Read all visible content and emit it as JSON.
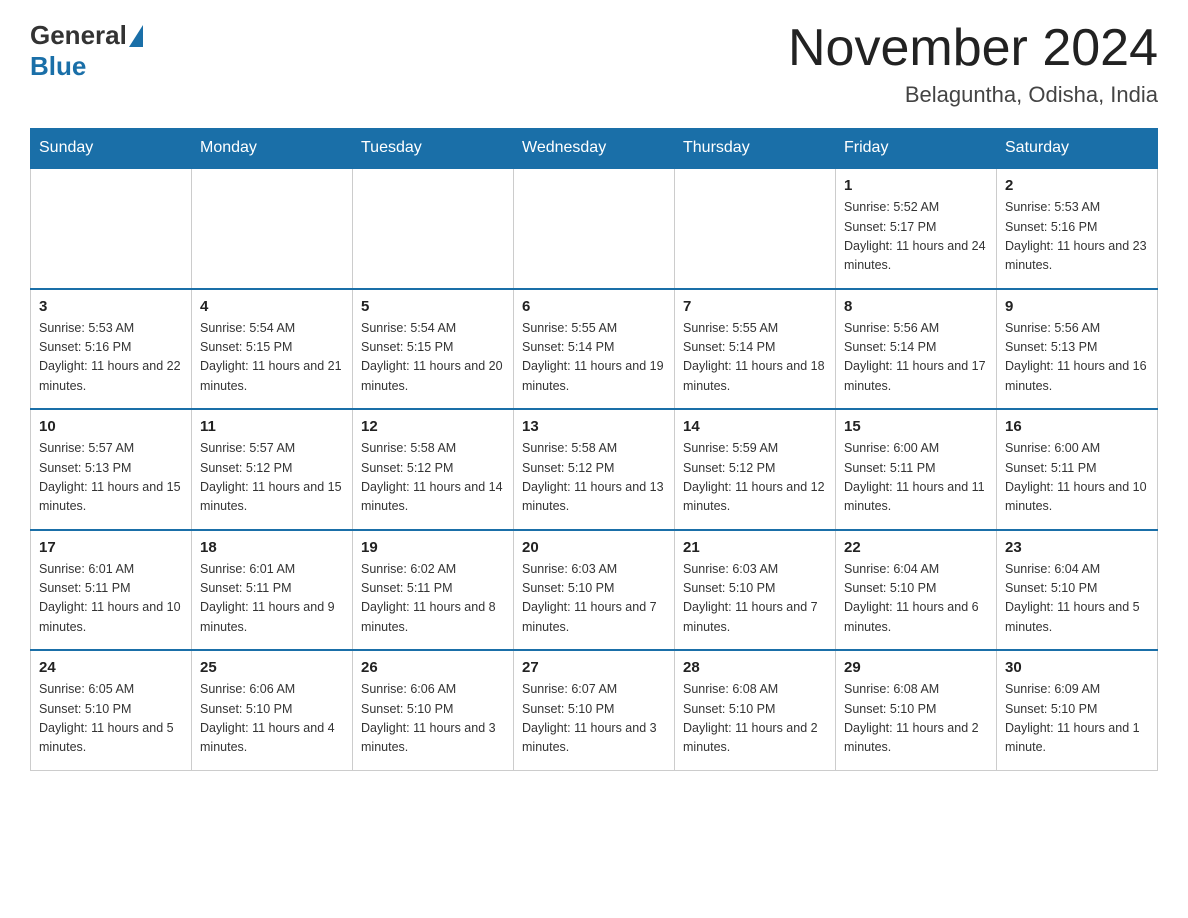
{
  "header": {
    "logo_general": "General",
    "logo_blue": "Blue",
    "title": "November 2024",
    "subtitle": "Belaguntha, Odisha, India"
  },
  "weekdays": [
    "Sunday",
    "Monday",
    "Tuesday",
    "Wednesday",
    "Thursday",
    "Friday",
    "Saturday"
  ],
  "weeks": [
    [
      {
        "day": "",
        "info": ""
      },
      {
        "day": "",
        "info": ""
      },
      {
        "day": "",
        "info": ""
      },
      {
        "day": "",
        "info": ""
      },
      {
        "day": "",
        "info": ""
      },
      {
        "day": "1",
        "info": "Sunrise: 5:52 AM\nSunset: 5:17 PM\nDaylight: 11 hours and 24 minutes."
      },
      {
        "day": "2",
        "info": "Sunrise: 5:53 AM\nSunset: 5:16 PM\nDaylight: 11 hours and 23 minutes."
      }
    ],
    [
      {
        "day": "3",
        "info": "Sunrise: 5:53 AM\nSunset: 5:16 PM\nDaylight: 11 hours and 22 minutes."
      },
      {
        "day": "4",
        "info": "Sunrise: 5:54 AM\nSunset: 5:15 PM\nDaylight: 11 hours and 21 minutes."
      },
      {
        "day": "5",
        "info": "Sunrise: 5:54 AM\nSunset: 5:15 PM\nDaylight: 11 hours and 20 minutes."
      },
      {
        "day": "6",
        "info": "Sunrise: 5:55 AM\nSunset: 5:14 PM\nDaylight: 11 hours and 19 minutes."
      },
      {
        "day": "7",
        "info": "Sunrise: 5:55 AM\nSunset: 5:14 PM\nDaylight: 11 hours and 18 minutes."
      },
      {
        "day": "8",
        "info": "Sunrise: 5:56 AM\nSunset: 5:14 PM\nDaylight: 11 hours and 17 minutes."
      },
      {
        "day": "9",
        "info": "Sunrise: 5:56 AM\nSunset: 5:13 PM\nDaylight: 11 hours and 16 minutes."
      }
    ],
    [
      {
        "day": "10",
        "info": "Sunrise: 5:57 AM\nSunset: 5:13 PM\nDaylight: 11 hours and 15 minutes."
      },
      {
        "day": "11",
        "info": "Sunrise: 5:57 AM\nSunset: 5:12 PM\nDaylight: 11 hours and 15 minutes."
      },
      {
        "day": "12",
        "info": "Sunrise: 5:58 AM\nSunset: 5:12 PM\nDaylight: 11 hours and 14 minutes."
      },
      {
        "day": "13",
        "info": "Sunrise: 5:58 AM\nSunset: 5:12 PM\nDaylight: 11 hours and 13 minutes."
      },
      {
        "day": "14",
        "info": "Sunrise: 5:59 AM\nSunset: 5:12 PM\nDaylight: 11 hours and 12 minutes."
      },
      {
        "day": "15",
        "info": "Sunrise: 6:00 AM\nSunset: 5:11 PM\nDaylight: 11 hours and 11 minutes."
      },
      {
        "day": "16",
        "info": "Sunrise: 6:00 AM\nSunset: 5:11 PM\nDaylight: 11 hours and 10 minutes."
      }
    ],
    [
      {
        "day": "17",
        "info": "Sunrise: 6:01 AM\nSunset: 5:11 PM\nDaylight: 11 hours and 10 minutes."
      },
      {
        "day": "18",
        "info": "Sunrise: 6:01 AM\nSunset: 5:11 PM\nDaylight: 11 hours and 9 minutes."
      },
      {
        "day": "19",
        "info": "Sunrise: 6:02 AM\nSunset: 5:11 PM\nDaylight: 11 hours and 8 minutes."
      },
      {
        "day": "20",
        "info": "Sunrise: 6:03 AM\nSunset: 5:10 PM\nDaylight: 11 hours and 7 minutes."
      },
      {
        "day": "21",
        "info": "Sunrise: 6:03 AM\nSunset: 5:10 PM\nDaylight: 11 hours and 7 minutes."
      },
      {
        "day": "22",
        "info": "Sunrise: 6:04 AM\nSunset: 5:10 PM\nDaylight: 11 hours and 6 minutes."
      },
      {
        "day": "23",
        "info": "Sunrise: 6:04 AM\nSunset: 5:10 PM\nDaylight: 11 hours and 5 minutes."
      }
    ],
    [
      {
        "day": "24",
        "info": "Sunrise: 6:05 AM\nSunset: 5:10 PM\nDaylight: 11 hours and 5 minutes."
      },
      {
        "day": "25",
        "info": "Sunrise: 6:06 AM\nSunset: 5:10 PM\nDaylight: 11 hours and 4 minutes."
      },
      {
        "day": "26",
        "info": "Sunrise: 6:06 AM\nSunset: 5:10 PM\nDaylight: 11 hours and 3 minutes."
      },
      {
        "day": "27",
        "info": "Sunrise: 6:07 AM\nSunset: 5:10 PM\nDaylight: 11 hours and 3 minutes."
      },
      {
        "day": "28",
        "info": "Sunrise: 6:08 AM\nSunset: 5:10 PM\nDaylight: 11 hours and 2 minutes."
      },
      {
        "day": "29",
        "info": "Sunrise: 6:08 AM\nSunset: 5:10 PM\nDaylight: 11 hours and 2 minutes."
      },
      {
        "day": "30",
        "info": "Sunrise: 6:09 AM\nSunset: 5:10 PM\nDaylight: 11 hours and 1 minute."
      }
    ]
  ]
}
